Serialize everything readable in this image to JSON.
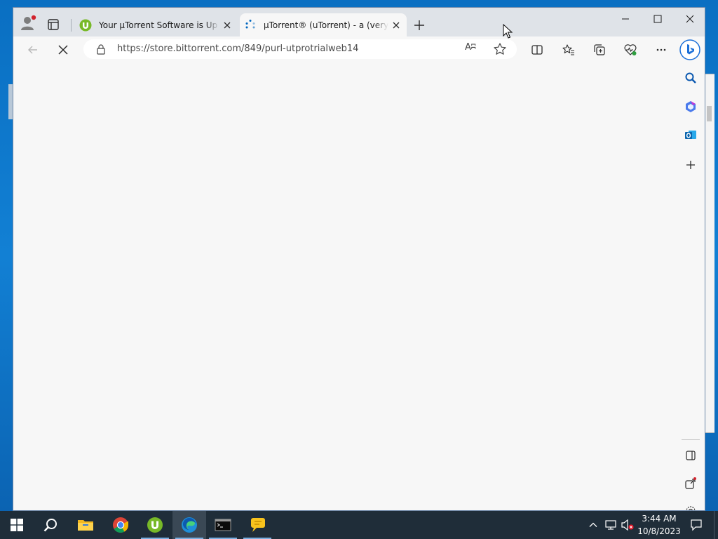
{
  "browser": {
    "tabs": [
      {
        "title": "Your µTorrent Software is Up to Date",
        "favicon": "utorrent-icon",
        "active": false
      },
      {
        "title": "µTorrent® (uTorrent) - a (very) tiny BitTorrent client",
        "favicon": "loading-spinner-icon",
        "active": true
      }
    ],
    "address_bar": {
      "url": "https://store.bittorrent.com/849/purl-utprotrialweb14"
    },
    "read_aloud_glyph": "Aʭ",
    "accent": "#0067c0"
  },
  "taskbar": {
    "apps": [
      {
        "name": "File Explorer",
        "icon": "folder-icon"
      },
      {
        "name": "Google Chrome",
        "icon": "chrome-icon"
      },
      {
        "name": "µTorrent",
        "icon": "utorrent-icon"
      },
      {
        "name": "Microsoft Edge",
        "icon": "edge-icon"
      },
      {
        "name": "Command Prompt",
        "icon": "terminal-icon"
      },
      {
        "name": "Messaging",
        "icon": "chat-icon"
      }
    ],
    "clock": {
      "time": "3:44 AM",
      "date": "10/8/2023"
    }
  },
  "colors": {
    "taskbar_bg": "#1f2d39",
    "titlebar_bg": "#dfe3e8",
    "content_bg": "#f7f7f7",
    "utorrent_green": "#78b928"
  }
}
